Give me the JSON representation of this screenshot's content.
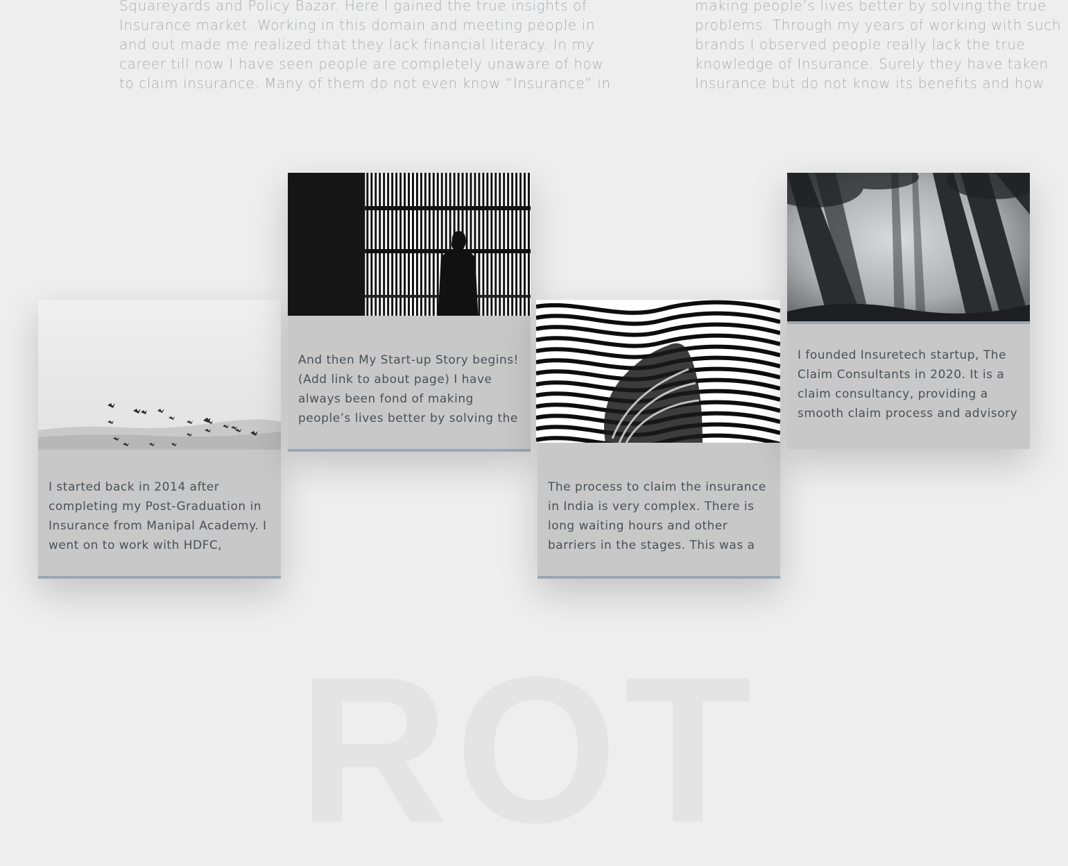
{
  "intro": {
    "left": "Squareyards and Policy Bazar. Here I gained the true insights of Insurance market. Working in this domain and meeting people in and out made me realized that they lack financial literacy. In my career till now I have seen people are completely unaware of how to claim insurance. Many of them do not even know “Insurance” in general.",
    "right": "making people’s lives better by solving the true problems. Through my years of working with such brands I observed people really lack the true knowledge of Insurance. Surely they have taken Insurance but do not know its benefits and how to"
  },
  "cards": [
    {
      "image": "birds-flying-over-hill-photo",
      "text": "I started back in 2014 after completing my Post-Graduation in Insurance from Manipal Academy. I went on to work with HDFC,"
    },
    {
      "image": "silhouette-against-striped-wall-photo",
      "text": "And then My Start-up Story begins! (Add link to about page) I have always been fond of making people’s lives better by solving the"
    },
    {
      "image": "wavy-stripes-figure-photo",
      "text": "The process to claim the insurance in India is very complex. There is long waiting hours and other barriers in the stages. This was a"
    },
    {
      "image": "foggy-forest-trees-photo",
      "text": "I founded Insuretech startup, The Claim Consultants in 2020. It is a claim consultancy, providing a smooth claim process and advisory"
    }
  ],
  "background_word": "ROT"
}
